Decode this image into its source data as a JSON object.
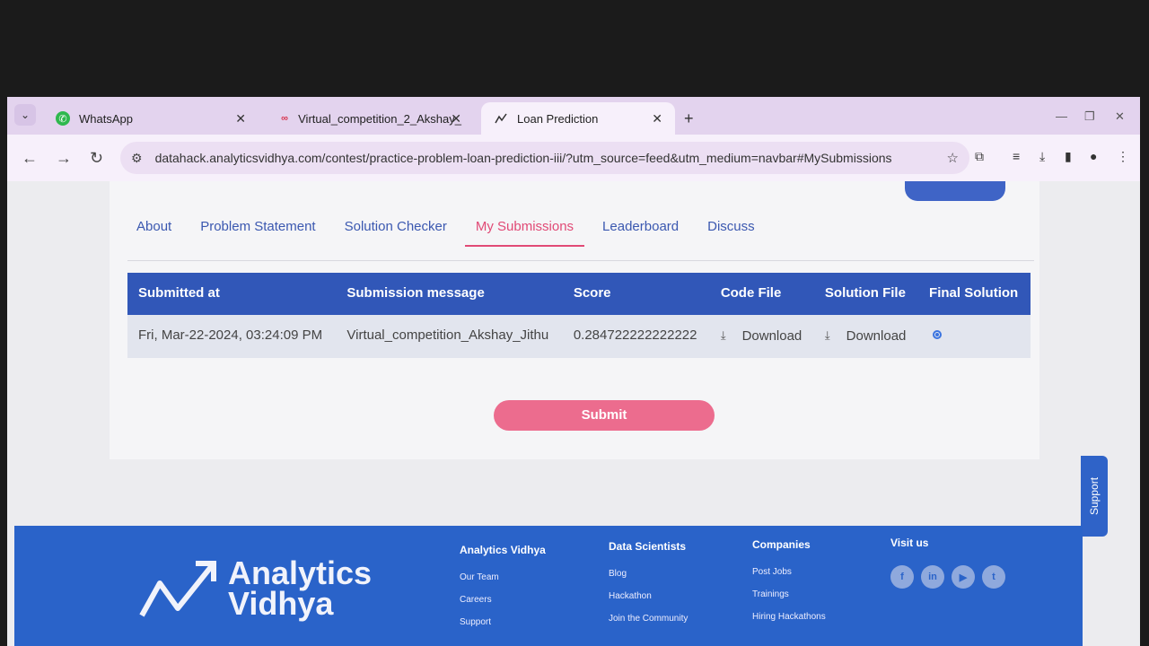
{
  "browser": {
    "tabs": [
      {
        "title": "WhatsApp",
        "icon": "whatsapp-icon"
      },
      {
        "title": "Virtual_competition_2_Akshay_",
        "icon": "infinity-icon"
      },
      {
        "title": "Loan Prediction",
        "icon": "chart-line-icon",
        "active": true
      }
    ],
    "url": "datahack.analyticsvidhya.com/contest/practice-problem-loan-prediction-iii/?utm_source=feed&utm_medium=navbar#MySubmissions"
  },
  "page": {
    "nav_tabs": [
      {
        "label": "About"
      },
      {
        "label": "Problem Statement"
      },
      {
        "label": "Solution Checker"
      },
      {
        "label": "My Submissions",
        "active": true
      },
      {
        "label": "Leaderboard"
      },
      {
        "label": "Discuss"
      }
    ],
    "table": {
      "headers": [
        "Submitted at",
        "Submission message",
        "Score",
        "Code File",
        "Solution File",
        "Final Solution"
      ],
      "rows": [
        {
          "submitted_at": "Fri, Mar-22-2024, 03:24:09 PM",
          "message": "Virtual_competition_Akshay_Jithu",
          "score": "0.284722222222222",
          "code_file": "Download",
          "solution_file": "Download",
          "final_selected": true
        }
      ]
    },
    "submit_label": "Submit",
    "support_label": "Support"
  },
  "footer": {
    "logo_line1": "Analytics",
    "logo_line2": "Vidhya",
    "columns": [
      {
        "title": "Analytics Vidhya",
        "links": [
          "Our Team",
          "Careers",
          "Support"
        ]
      },
      {
        "title": "Data Scientists",
        "links": [
          "Blog",
          "Hackathon",
          "Join the Community"
        ]
      },
      {
        "title": "Companies",
        "links": [
          "Post Jobs",
          "Trainings",
          "Hiring Hackathons"
        ]
      }
    ],
    "visit_us": "Visit us",
    "social": [
      "f",
      "in",
      "▶",
      "t"
    ]
  },
  "colors": {
    "accent_blue": "#3157b8",
    "accent_pink": "#e14a76",
    "footer_blue": "#2a63c9"
  }
}
